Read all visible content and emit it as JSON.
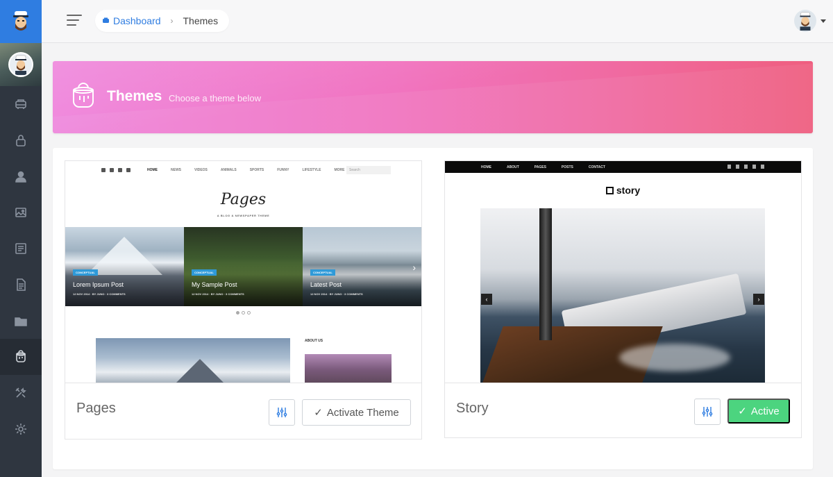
{
  "breadcrumb": {
    "home": "Dashboard",
    "current": "Themes"
  },
  "banner": {
    "title": "Themes",
    "subtitle": "Choose a theme below",
    "icon": "paint-bucket-icon"
  },
  "sidebar": {
    "active_item": "themes",
    "items": [
      {
        "id": "dashboard",
        "icon": "dashboard-icon"
      },
      {
        "id": "lock",
        "icon": "lock-icon"
      },
      {
        "id": "users",
        "icon": "user-icon"
      },
      {
        "id": "media",
        "icon": "image-icon"
      },
      {
        "id": "posts",
        "icon": "newspaper-icon"
      },
      {
        "id": "pages",
        "icon": "document-icon"
      },
      {
        "id": "folders",
        "icon": "folder-icon"
      },
      {
        "id": "themes",
        "icon": "paint-bucket-icon"
      },
      {
        "id": "tools",
        "icon": "tools-icon"
      },
      {
        "id": "settings",
        "icon": "gear-icon"
      }
    ]
  },
  "themes": [
    {
      "name": "Pages",
      "action_label": "Activate Theme",
      "active": false,
      "preview": {
        "nav": [
          "HOME",
          "NEWS",
          "VIDEOS",
          "ANIMALS",
          "SPORTS",
          "FUNNY",
          "LIFESTYLE",
          "MORE"
        ],
        "search_placeholder": "Search",
        "logo": "Pages",
        "tagline": "A BLOG & NEWSPAPER THEME",
        "slides": [
          {
            "tag": "CONCEPTUAL",
            "title": "Lorem Ipsum Post",
            "meta": "12 NOV 2014 · BY JUNO · 3 COMMENTS"
          },
          {
            "tag": "CONCEPTUAL",
            "title": "My Sample Post",
            "meta": "12 NOV 2014 · BY JUNO · 3 COMMENTS"
          },
          {
            "tag": "CONCEPTUAL",
            "title": "Latest Post",
            "meta": "12 NOV 2014 · BY JUNO · 3 COMMENTS"
          }
        ],
        "about_label": "ABOUT US"
      }
    },
    {
      "name": "Story",
      "action_label": "Active",
      "active": true,
      "preview": {
        "nav": [
          "HOME",
          "ABOUT",
          "PAGES",
          "POSTS",
          "CONTACT"
        ],
        "logo": "story"
      }
    }
  ],
  "colors": {
    "primary": "#2f7de1",
    "active_button": "#4cd47f",
    "sidebar": "#2f3640"
  }
}
